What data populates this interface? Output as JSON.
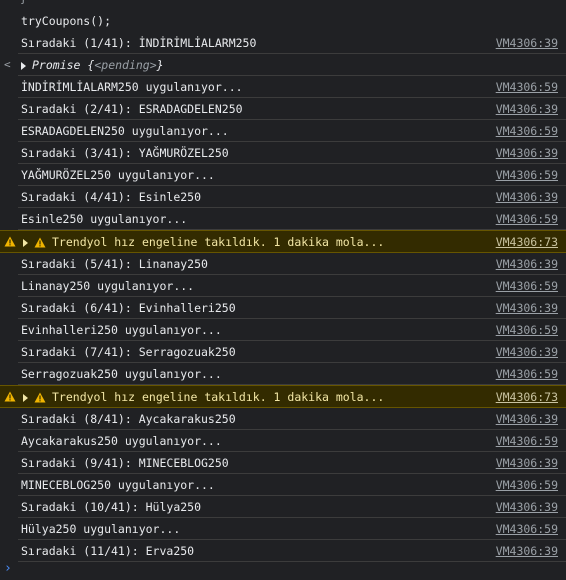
{
  "console": {
    "top_stub": "}",
    "command": "tryCoupons();",
    "promise": {
      "label": "Promise",
      "value_open": "{",
      "value": "<pending>",
      "value_close": "}"
    },
    "rows": [
      {
        "kind": "log",
        "text": "Sıradaki (1/41): İNDİRİMLİALARM250",
        "src": "VM4306:39"
      },
      {
        "kind": "promise"
      },
      {
        "kind": "log",
        "text": "İNDİRİMLİALARM250 uygulanıyor...",
        "src": "VM4306:59"
      },
      {
        "kind": "log",
        "text": "Sıradaki (2/41): ESRADAGDELEN250",
        "src": "VM4306:39"
      },
      {
        "kind": "log",
        "text": "ESRADAGDELEN250 uygulanıyor...",
        "src": "VM4306:59"
      },
      {
        "kind": "log",
        "text": "Sıradaki (3/41): YAĞMURÖZEL250",
        "src": "VM4306:39"
      },
      {
        "kind": "log",
        "text": "YAĞMURÖZEL250 uygulanıyor...",
        "src": "VM4306:59"
      },
      {
        "kind": "log",
        "text": "Sıradaki (4/41): Esinle250",
        "src": "VM4306:39"
      },
      {
        "kind": "log",
        "text": "Esinle250 uygulanıyor...",
        "src": "VM4306:59"
      },
      {
        "kind": "warn",
        "text": "Trendyol hız engeline takıldık. 1 dakika mola...",
        "src": "VM4306:73"
      },
      {
        "kind": "log",
        "text": "Sıradaki (5/41): Linanay250",
        "src": "VM4306:39"
      },
      {
        "kind": "log",
        "text": "Linanay250 uygulanıyor...",
        "src": "VM4306:59"
      },
      {
        "kind": "log",
        "text": "Sıradaki (6/41): Evinhalleri250",
        "src": "VM4306:39"
      },
      {
        "kind": "log",
        "text": "Evinhalleri250 uygulanıyor...",
        "src": "VM4306:59"
      },
      {
        "kind": "log",
        "text": "Sıradaki (7/41): Serragozuak250",
        "src": "VM4306:39"
      },
      {
        "kind": "log",
        "text": "Serragozuak250 uygulanıyor...",
        "src": "VM4306:59"
      },
      {
        "kind": "warn",
        "text": "Trendyol hız engeline takıldık. 1 dakika mola...",
        "src": "VM4306:73"
      },
      {
        "kind": "log",
        "text": "Sıradaki (8/41): Aycakarakus250",
        "src": "VM4306:39"
      },
      {
        "kind": "log",
        "text": "Aycakarakus250 uygulanıyor...",
        "src": "VM4306:59"
      },
      {
        "kind": "log",
        "text": "Sıradaki (9/41): MINECEBLOG250",
        "src": "VM4306:39"
      },
      {
        "kind": "log",
        "text": "MINECEBLOG250 uygulanıyor...",
        "src": "VM4306:59"
      },
      {
        "kind": "log",
        "text": "Sıradaki (10/41): Hülya250",
        "src": "VM4306:39"
      },
      {
        "kind": "log",
        "text": "Hülya250 uygulanıyor...",
        "src": "VM4306:59"
      },
      {
        "kind": "log",
        "text": "Sıradaki (11/41): Erva250",
        "src": "VM4306:39"
      }
    ],
    "prompt_symbol": "›",
    "colors": {
      "background": "#202124",
      "warning_bg": "#332b00",
      "warning_text": "#f2e6a5",
      "link": "#9aa0a6",
      "prompt": "#4a8cf7"
    }
  }
}
